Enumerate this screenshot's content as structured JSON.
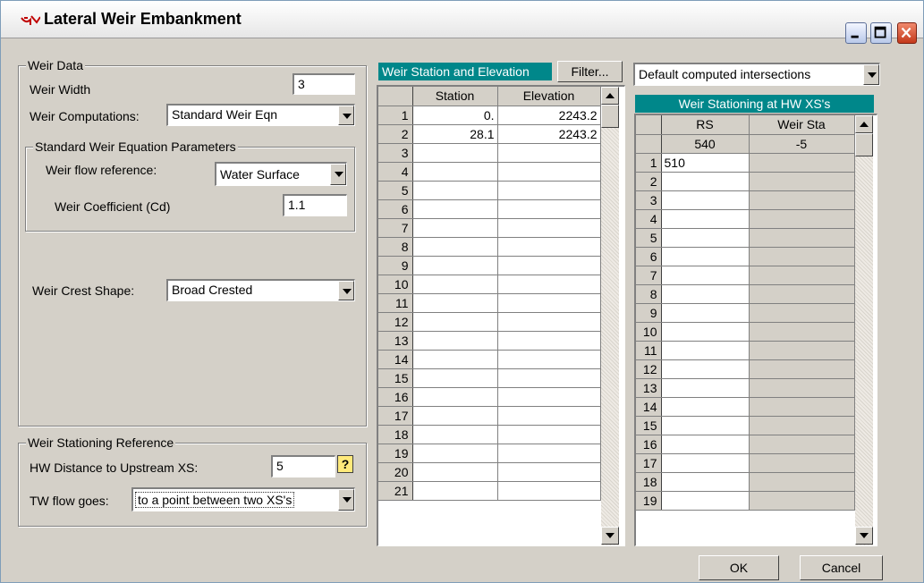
{
  "window": {
    "title": "Lateral Weir Embankment"
  },
  "weir_data": {
    "legend": "Weir Data",
    "width_label": "Weir Width",
    "width_value": "3",
    "computations_label": "Weir Computations:",
    "computations_value": "Standard Weir Eqn",
    "params_legend": "Standard Weir Equation Parameters",
    "flow_ref_label": "Weir flow reference:",
    "flow_ref_value": "Water Surface",
    "coef_label": "Weir Coefficient (Cd)",
    "coef_value": "1.1",
    "crest_label": "Weir Crest Shape:",
    "crest_value": "Broad Crested"
  },
  "stationing_ref": {
    "legend": "Weir Stationing Reference",
    "hw_label": "HW Distance to Upstream XS:",
    "hw_value": "5",
    "help_glyph": "?",
    "tw_label": "TW flow goes:",
    "tw_value": "to a point between two XS's"
  },
  "station_elev": {
    "header": "Weir Station and Elevation",
    "filter_label": "Filter...",
    "columns": [
      "Station",
      "Elevation"
    ],
    "rows": [
      {
        "n": "1",
        "station": "0.",
        "elevation": "2243.2"
      },
      {
        "n": "2",
        "station": "28.1",
        "elevation": "2243.2"
      },
      {
        "n": "3",
        "station": "",
        "elevation": ""
      },
      {
        "n": "4",
        "station": "",
        "elevation": ""
      },
      {
        "n": "5",
        "station": "",
        "elevation": ""
      },
      {
        "n": "6",
        "station": "",
        "elevation": ""
      },
      {
        "n": "7",
        "station": "",
        "elevation": ""
      },
      {
        "n": "8",
        "station": "",
        "elevation": ""
      },
      {
        "n": "9",
        "station": "",
        "elevation": ""
      },
      {
        "n": "10",
        "station": "",
        "elevation": ""
      },
      {
        "n": "11",
        "station": "",
        "elevation": ""
      },
      {
        "n": "12",
        "station": "",
        "elevation": ""
      },
      {
        "n": "13",
        "station": "",
        "elevation": ""
      },
      {
        "n": "14",
        "station": "",
        "elevation": ""
      },
      {
        "n": "15",
        "station": "",
        "elevation": ""
      },
      {
        "n": "16",
        "station": "",
        "elevation": ""
      },
      {
        "n": "17",
        "station": "",
        "elevation": ""
      },
      {
        "n": "18",
        "station": "",
        "elevation": ""
      },
      {
        "n": "19",
        "station": "",
        "elevation": ""
      },
      {
        "n": "20",
        "station": "",
        "elevation": ""
      },
      {
        "n": "21",
        "station": "",
        "elevation": ""
      }
    ]
  },
  "hw_stationing": {
    "dropdown_value": "Default computed intersections",
    "header": "Weir Stationing at HW XS's",
    "columns": [
      "RS",
      "Weir Sta"
    ],
    "first_row": {
      "rs": "540",
      "sta": "-5"
    },
    "rows": [
      {
        "n": "1",
        "rs": "510",
        "sta": ""
      },
      {
        "n": "2",
        "rs": "",
        "sta": ""
      },
      {
        "n": "3",
        "rs": "",
        "sta": ""
      },
      {
        "n": "4",
        "rs": "",
        "sta": ""
      },
      {
        "n": "5",
        "rs": "",
        "sta": ""
      },
      {
        "n": "6",
        "rs": "",
        "sta": ""
      },
      {
        "n": "7",
        "rs": "",
        "sta": ""
      },
      {
        "n": "8",
        "rs": "",
        "sta": ""
      },
      {
        "n": "9",
        "rs": "",
        "sta": ""
      },
      {
        "n": "10",
        "rs": "",
        "sta": ""
      },
      {
        "n": "11",
        "rs": "",
        "sta": ""
      },
      {
        "n": "12",
        "rs": "",
        "sta": ""
      },
      {
        "n": "13",
        "rs": "",
        "sta": ""
      },
      {
        "n": "14",
        "rs": "",
        "sta": ""
      },
      {
        "n": "15",
        "rs": "",
        "sta": ""
      },
      {
        "n": "16",
        "rs": "",
        "sta": ""
      },
      {
        "n": "17",
        "rs": "",
        "sta": ""
      },
      {
        "n": "18",
        "rs": "",
        "sta": ""
      },
      {
        "n": "19",
        "rs": "",
        "sta": ""
      }
    ]
  },
  "buttons": {
    "ok": "OK",
    "cancel": "Cancel"
  },
  "colors": {
    "window_bg": "#d4d0c8",
    "teal_header": "#00878a",
    "close_red": "#c4391b"
  }
}
